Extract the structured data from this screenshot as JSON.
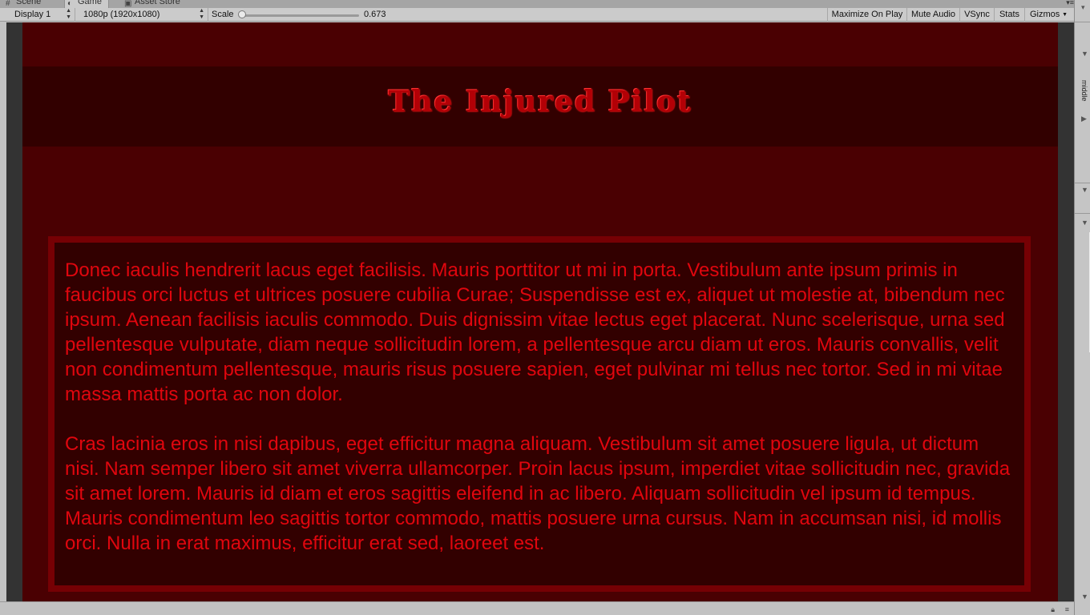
{
  "tabs": [
    {
      "label": "Scene",
      "icon": "scene-hash-icon"
    },
    {
      "label": "Game",
      "icon": "game-pacman-icon"
    },
    {
      "label": "Asset Store",
      "icon": "store-bag-icon"
    }
  ],
  "toolbar": {
    "display": "Display 1",
    "resolution": "1080p (1920x1080)",
    "scale_label": "Scale",
    "scale_value": "0.673",
    "maximize_on_play": "Maximize On Play",
    "mute_audio": "Mute Audio",
    "vsync": "VSync",
    "stats": "Stats",
    "gizmos": "Gizmos"
  },
  "inspector": {
    "label": "middle"
  },
  "game": {
    "title": "The Injured Pilot",
    "paragraphs": [
      "Donec iaculis hendrerit lacus eget facilisis. Mauris porttitor ut mi in porta. Vestibulum ante ipsum primis in faucibus orci luctus et ultrices posuere cubilia Curae; Suspendisse est ex, aliquet ut molestie at, bibendum nec ipsum. Aenean facilisis iaculis commodo. Duis dignissim vitae lectus eget placerat. Nunc scelerisque, urna sed pellentesque vulputate, diam neque sollicitudin lorem, a pellentesque arcu diam ut eros. Mauris convallis, velit non condimentum pellentesque, mauris risus posuere sapien, eget pulvinar mi tellus nec tortor. Sed in mi vitae massa mattis porta ac non dolor.",
      "Cras lacinia eros in nisi dapibus, eget efficitur magna aliquam. Vestibulum sit amet posuere ligula, ut dictum nisi. Nam semper libero sit amet viverra ullamcorper. Proin lacus ipsum, imperdiet vitae sollicitudin nec, gravida sit amet lorem. Mauris id diam et eros sagittis eleifend in ac libero. Aliquam sollicitudin vel ipsum id tempus. Mauris condimentum leo sagittis tortor commodo, mattis posuere urna cursus. Nam in accumsan nisi, id mollis orci. Nulla in erat maximus, efficitur erat sed, laoreet est."
    ]
  },
  "colors": {
    "game_background": "#4a0002",
    "header_band": "#320000",
    "panel_border": "#760004",
    "text": "#e0060e",
    "title": "#b30006"
  }
}
